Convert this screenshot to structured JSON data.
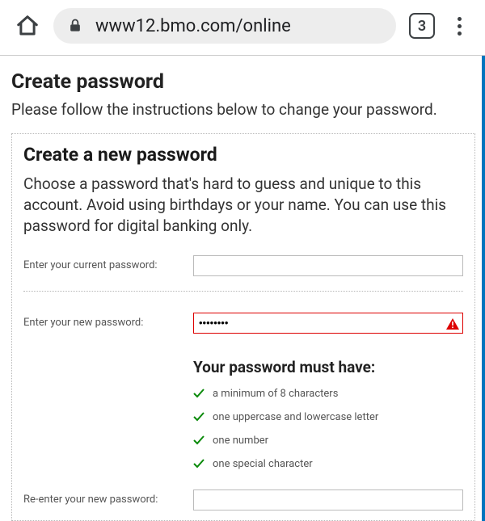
{
  "browser": {
    "url": "www12.bmo.com/online",
    "tab_count": "3"
  },
  "page": {
    "title": "Create password",
    "subtitle": "Please follow the instructions below to change your password."
  },
  "card": {
    "title": "Create a new password",
    "description": "Choose a password that's hard to guess and unique to this account. Avoid using birthdays or your name. You can use this password for digital banking only.",
    "fields": {
      "current_label": "Enter your current password:",
      "current_value": "",
      "new_label": "Enter your new password:",
      "new_value": "••••••••",
      "confirm_label": "Re-enter your new password:",
      "confirm_value": ""
    },
    "requirements": {
      "title": "Your password must have:",
      "items": [
        "a minimum of 8 characters",
        "one uppercase and lowercase letter",
        "one number",
        "one special character"
      ]
    }
  },
  "colors": {
    "accent": "#0075be",
    "error": "#d00",
    "check": "#0a8a0a"
  }
}
